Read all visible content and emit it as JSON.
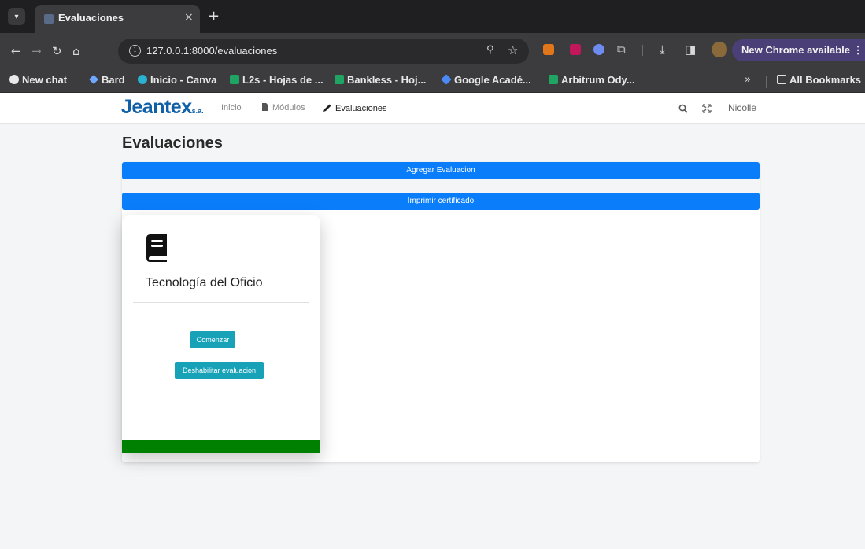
{
  "browser": {
    "tab_title": "Evaluaciones",
    "tab_close": "×",
    "new_tab": "+",
    "url": "127.0.0.1:8000/evaluaciones",
    "update_label": "New Chrome available",
    "bookmarks": [
      {
        "label": "New chat",
        "color": "#e8e8e8"
      },
      {
        "label": "Bard",
        "color": "#6fa8ff"
      },
      {
        "label": "Inicio - Canva",
        "color": "#2ab3d1"
      },
      {
        "label": "L2s - Hojas de ...",
        "color": "#1fa463"
      },
      {
        "label": "Bankless - Hoj...",
        "color": "#1fa463"
      },
      {
        "label": "Google Acadé...",
        "color": "#4a8af4"
      },
      {
        "label": "Arbitrum Ody...",
        "color": "#1fa463"
      }
    ],
    "bookmarks_more": "»",
    "all_bookmarks": "All Bookmarks"
  },
  "navbar": {
    "brand": "Jeantex",
    "brand_sub": "s.a.",
    "links": [
      "Inicio",
      "Módulos",
      "Evaluaciones"
    ],
    "user": "Nicolle"
  },
  "main": {
    "title": "Evaluaciones",
    "add_label": "Agregar Evaluacion",
    "print_label": "Imprimir certificado"
  },
  "card": {
    "title": "Tecnología del Oficio",
    "start_label": "Comenzar",
    "disable_label": "Deshabilitar evaluacion"
  },
  "colors": {
    "primary_button": "#0a7dfb",
    "teal_button": "#17a2b8",
    "card_footer": "#008000",
    "brand": "#1060a8"
  }
}
